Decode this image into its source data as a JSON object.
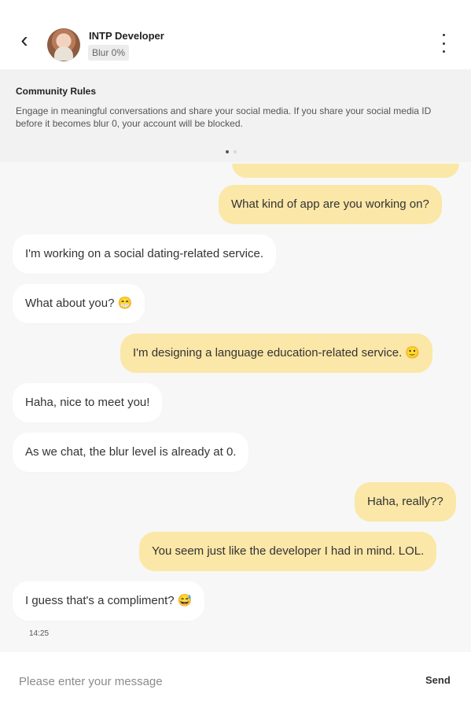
{
  "header": {
    "back_glyph": "‹",
    "profile_name": "INTP Developer",
    "blur_status": "Blur 0%"
  },
  "rules": {
    "title": "Community Rules",
    "text": "Engage in meaningful conversations and share your social media. If you share your social media ID before it becomes blur 0, your account will be blocked."
  },
  "messages": [
    {
      "side": "sent",
      "text": "What kind of app are you working on?"
    },
    {
      "side": "recv",
      "text": "I'm working on a social dating-related service."
    },
    {
      "side": "recv",
      "text": "What about you? 😁"
    },
    {
      "side": "sent",
      "text": "I'm designing a language education-related service. 🙂"
    },
    {
      "side": "recv",
      "text": "Haha, nice to meet you!"
    },
    {
      "side": "recv",
      "text": "As we chat, the blur level is already at 0."
    },
    {
      "side": "sent",
      "text": "Haha, really??"
    },
    {
      "side": "sent",
      "text": "You seem just like the developer I had in mind. LOL."
    },
    {
      "side": "recv",
      "text": "I guess that's a compliment? 😅"
    }
  ],
  "timestamp": "14:25",
  "composer": {
    "placeholder": "Please enter your message",
    "value": "",
    "send_label": "Send"
  },
  "colors": {
    "sent_bubble": "#fbe7a7",
    "received_bubble": "#ffffff",
    "background": "#f7f7f7"
  }
}
